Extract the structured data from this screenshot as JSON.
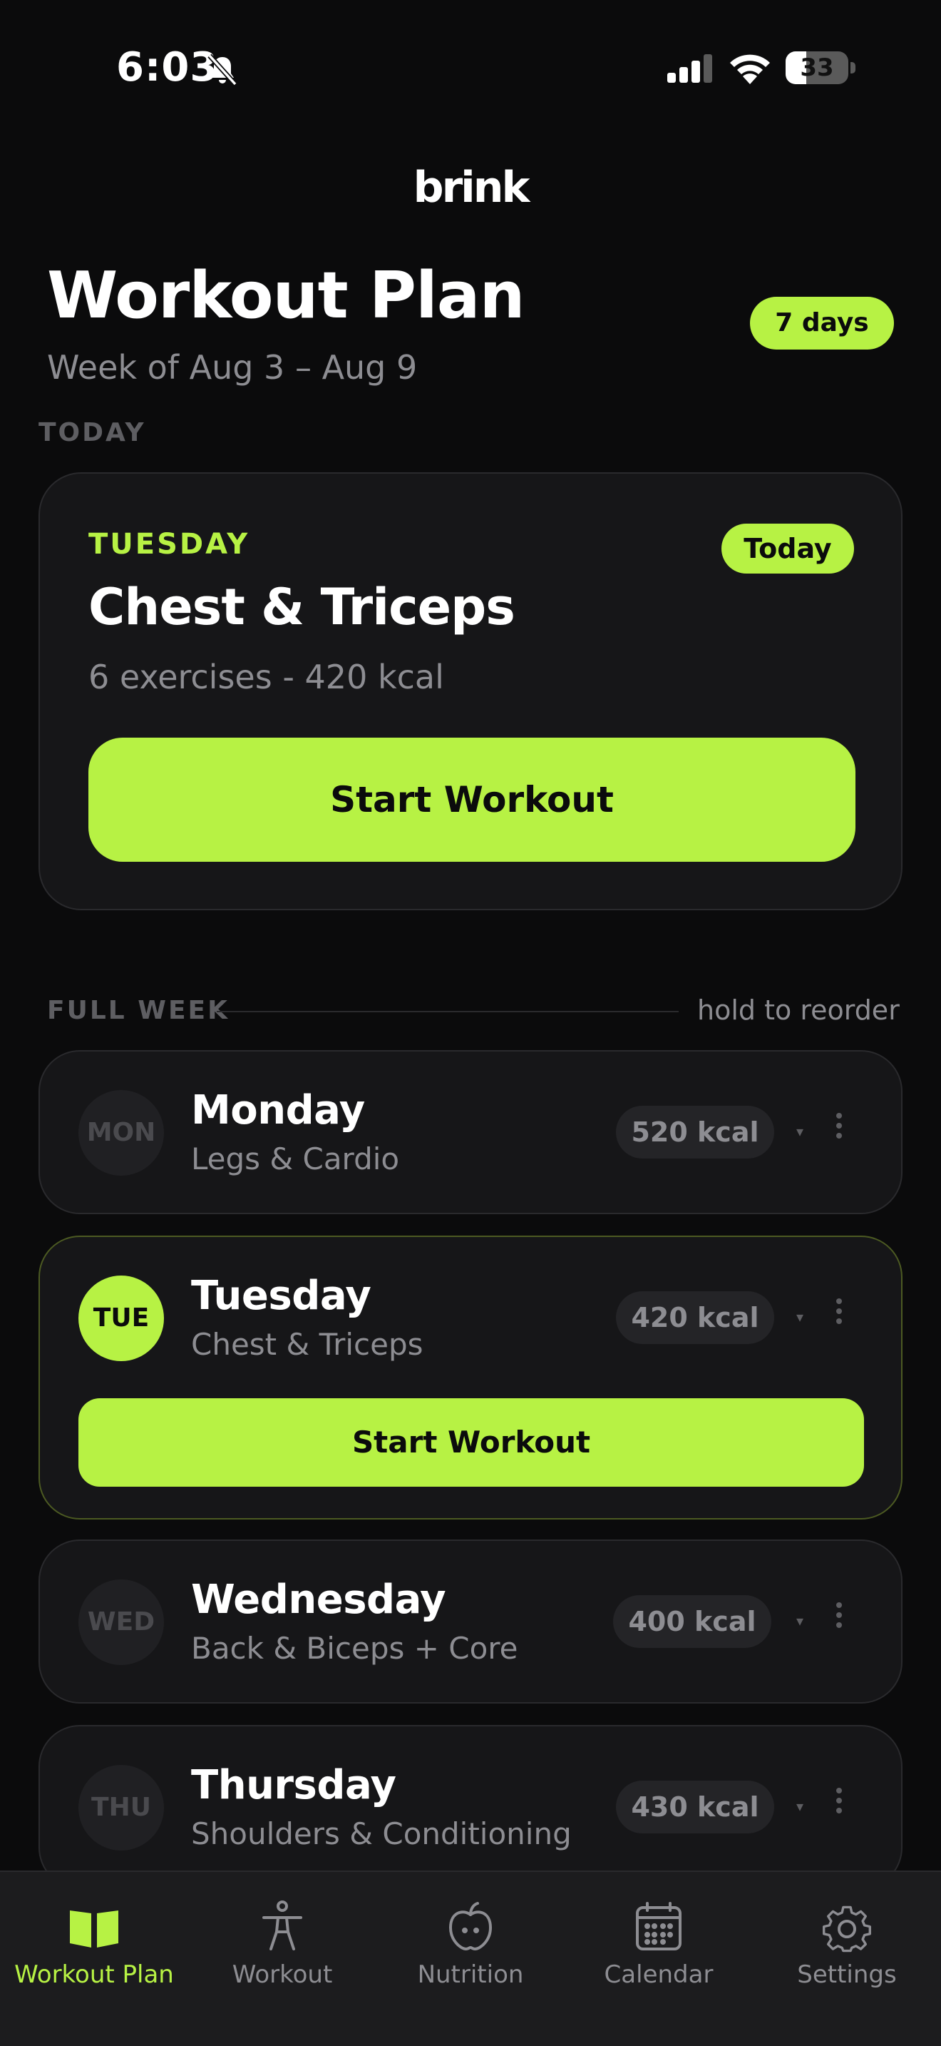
{
  "status_bar": {
    "time": "6:03",
    "battery_level": "33",
    "battery_fraction": 0.33,
    "icons": [
      "bell-off-icon",
      "signal-icon",
      "wifi-icon",
      "battery-icon"
    ]
  },
  "app": {
    "logo": "brink"
  },
  "header": {
    "title": "Workout Plan",
    "week_range": "Week of Aug 3 – Aug 9",
    "days_pill": "7 days"
  },
  "today_section": {
    "label": "TODAY",
    "card": {
      "day": "TUESDAY",
      "badge": "Today",
      "title": "Chest & Triceps",
      "summary": "6 exercises - 420 kcal",
      "button": "Start Workout"
    }
  },
  "week_section": {
    "label": "FULL WEEK",
    "hint": "hold to reorder",
    "days": [
      {
        "abbr": "MON",
        "name": "Monday",
        "focus": "Legs & Cardio",
        "kcal": "520 kcal",
        "active": false
      },
      {
        "abbr": "TUE",
        "name": "Tuesday",
        "focus": "Chest & Triceps",
        "kcal": "420 kcal",
        "active": true,
        "button": "Start Workout"
      },
      {
        "abbr": "WED",
        "name": "Wednesday",
        "focus": "Back & Biceps + Core",
        "kcal": "400 kcal",
        "active": false
      },
      {
        "abbr": "THU",
        "name": "Thursday",
        "focus": "Shoulders & Conditioning",
        "kcal": "430 kcal",
        "active": false
      }
    ]
  },
  "bottom_nav": {
    "items": [
      {
        "label": "Workout Plan",
        "icon": "book-open-icon",
        "active": true
      },
      {
        "label": "Workout",
        "icon": "person-icon",
        "active": false
      },
      {
        "label": "Nutrition",
        "icon": "apple-icon",
        "active": false
      },
      {
        "label": "Calendar",
        "icon": "calendar-icon",
        "active": false
      },
      {
        "label": "Settings",
        "icon": "gear-icon",
        "active": false
      }
    ]
  },
  "colors": {
    "accent": "#b7f244",
    "background": "#0b0b0c",
    "card": "#161618",
    "muted_text": "#8d8d92"
  }
}
